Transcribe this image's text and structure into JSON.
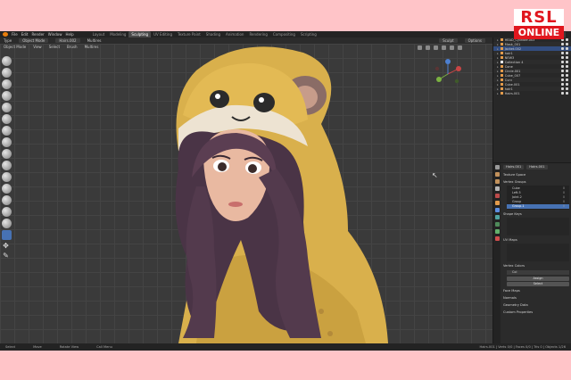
{
  "menubar": {
    "items": [
      "File",
      "Edit",
      "Render",
      "Window",
      "Help"
    ],
    "workspaces": [
      "Layout",
      "Modeling",
      "Sculpting",
      "UV Editing",
      "Texture Paint",
      "Shading",
      "Animation",
      "Rendering",
      "Compositing",
      "Scripting"
    ],
    "active_workspace": "Sculpting",
    "scene": "Scene"
  },
  "header": {
    "type_label": "Type",
    "mode": "Object Mode",
    "object_name": "Hairs.002",
    "view": "View",
    "select": "Select",
    "brush": "Brush",
    "multires": "Multires",
    "right_a": "Sculpt",
    "right_b": "Options"
  },
  "outliner": {
    "rows": [
      {
        "label": "HEAD_Cylinder.003",
        "type": "mesh",
        "selected": false
      },
      {
        "label": "Mask_001",
        "type": "mesh",
        "selected": false
      },
      {
        "label": "Jacket.002",
        "type": "mesh",
        "selected": true
      },
      {
        "label": "hair1",
        "type": "mesh",
        "selected": false
      },
      {
        "label": "NEW3",
        "type": "mesh",
        "selected": false
      },
      {
        "label": "Collection 4",
        "type": "collection",
        "selected": false
      },
      {
        "label": "Cone",
        "type": "mesh",
        "selected": false
      },
      {
        "label": "Circle.001",
        "type": "mesh",
        "selected": false
      },
      {
        "label": "Cube_007",
        "type": "mesh",
        "selected": false
      },
      {
        "label": "Curv",
        "type": "mesh",
        "selected": false
      },
      {
        "label": "Cube.001",
        "type": "mesh",
        "selected": false
      },
      {
        "label": "hair1",
        "type": "mesh",
        "selected": false
      },
      {
        "label": "Hairs.001",
        "type": "mesh",
        "selected": false
      }
    ]
  },
  "properties": {
    "object": "Hairs.001",
    "sections": {
      "texture_space": "Texture Space",
      "vertex_groups": "Vertex Groups",
      "shape_keys": "Shape Keys",
      "uv_maps": "UV Maps",
      "vertex_colors": "Vertex Colors",
      "face_maps": "Face Maps",
      "normals": "Normals",
      "geometry_data": "Geometry Data",
      "custom_properties": "Custom Properties"
    },
    "vertex_group_list": [
      {
        "name": "Cube",
        "value": "0",
        "selected": false
      },
      {
        "name": "Left.5",
        "value": "0",
        "selected": false
      },
      {
        "name": "Joint.2",
        "value": "0",
        "selected": false
      },
      {
        "name": "Group",
        "value": "0",
        "selected": false
      },
      {
        "name": "Group.1",
        "value": "0",
        "selected": true
      }
    ],
    "color_field": "Col",
    "buttons": [
      "Assign",
      "Select"
    ]
  },
  "statusbar": {
    "items": [
      "Select",
      "Move",
      "Rotate View",
      "Call Menu"
    ],
    "stats": "Hairs.001 | Verts 0/0 | Faces 0/0 | Tris 0 | Objects 1/26"
  },
  "logo": {
    "top": "RSL",
    "bottom": "ONLINE"
  }
}
